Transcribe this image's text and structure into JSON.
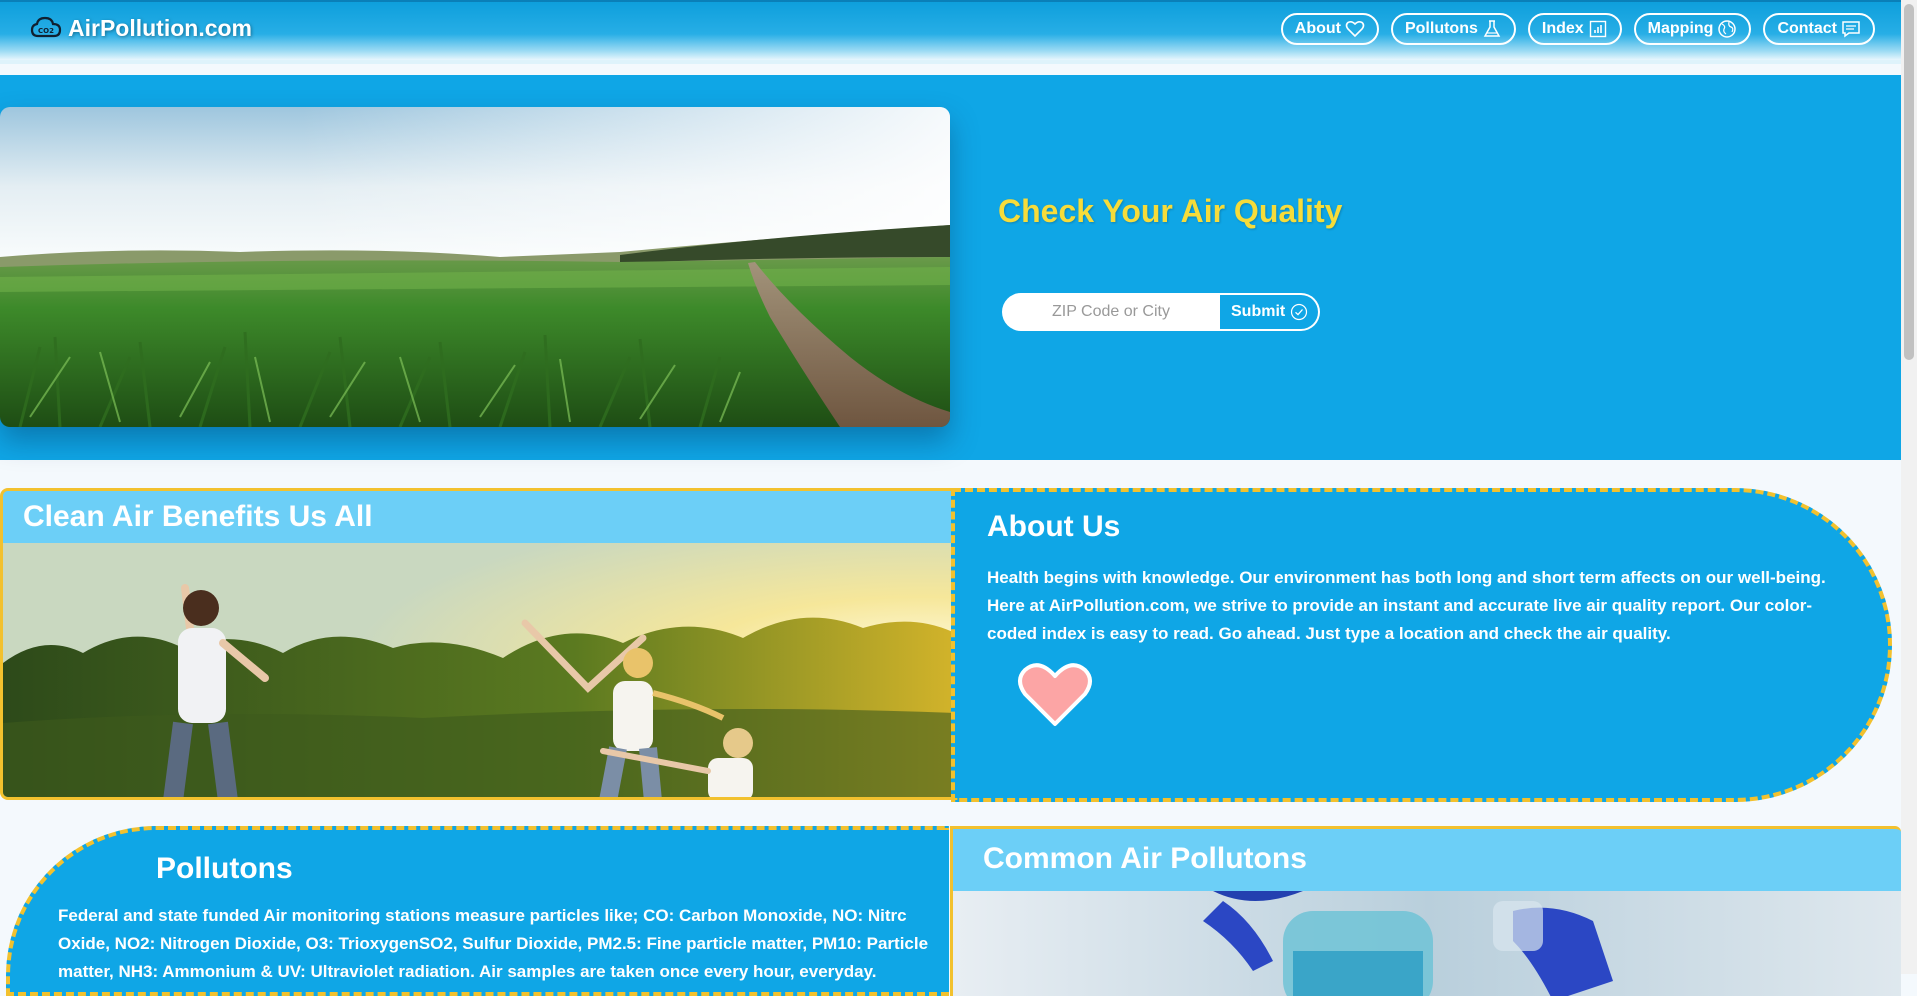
{
  "brand": {
    "name": "AirPollution.com",
    "logo_icon": "co2-cloud-icon",
    "logo_text": "CO2"
  },
  "nav": {
    "items": [
      {
        "label": "About",
        "icon": "heart-icon"
      },
      {
        "label": "Pollutons",
        "icon": "flask-icon"
      },
      {
        "label": "Index",
        "icon": "bar-chart-icon"
      },
      {
        "label": "Mapping",
        "icon": "globe-icon"
      },
      {
        "label": "Contact",
        "icon": "chat-icon"
      }
    ]
  },
  "hero": {
    "title": "Check Your Air Quality",
    "search_placeholder": "ZIP Code or City",
    "submit_label": "Submit",
    "submit_icon": "check-circle-icon",
    "image": "grass-field-photo"
  },
  "clean": {
    "title": "Clean Air Benefits Us All",
    "image": "family-playing-outdoors-photo"
  },
  "about": {
    "title": "About Us",
    "text": "Health begins with knowledge. Our environment has both long and short term affects on our well-being. Here at AirPollution.com, we strive to provide an instant and accurate live air quality report. Our color-coded index is easy to read. Go ahead. Just type a location and check the air quality.",
    "icon": "heart-icon"
  },
  "pollutons": {
    "title": "Pollutons",
    "text": "Federal and state funded Air monitoring stations measure particles like; CO: Carbon Monoxide, NO: Nitrc Oxide, NO2: Nitrogen Dioxide, O3: TrioxygenSO2, Sulfur Dioxide, PM2.5: Fine particle matter, PM10: Particle matter, NH3: Ammonium & UV: Ultraviolet radiation. Air samples are taken once every hour, everyday."
  },
  "common": {
    "title": "Common Air Pollutons",
    "image": "lab-scientist-photo"
  },
  "colors": {
    "primary": "#0fa6e6",
    "light": "#6ccff7",
    "accent": "#f6dc3a",
    "border": "#f2c12e",
    "heart": "#fca5a5"
  }
}
